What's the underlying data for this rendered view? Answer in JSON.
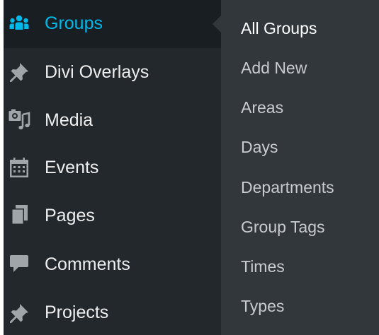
{
  "colors": {
    "menu_bg": "#23282d",
    "submenu_bg": "#32373c",
    "active_bg": "#191e23",
    "active_text": "#00b9eb",
    "menu_text": "#eeeeee",
    "icon_color": "#a0a5aa"
  },
  "menu": {
    "items": [
      {
        "label": "Groups",
        "icon": "groups-icon",
        "active": true
      },
      {
        "label": "Divi Overlays",
        "icon": "pushpin-icon"
      },
      {
        "label": "Media",
        "icon": "media-icon"
      },
      {
        "label": "Events",
        "icon": "calendar-icon"
      },
      {
        "label": "Pages",
        "icon": "pages-icon"
      },
      {
        "label": "Comments",
        "icon": "comment-icon"
      },
      {
        "label": "Projects",
        "icon": "pushpin-icon"
      }
    ]
  },
  "submenu": {
    "items": [
      {
        "label": "All Groups",
        "current": true
      },
      {
        "label": "Add New"
      },
      {
        "label": "Areas"
      },
      {
        "label": "Days"
      },
      {
        "label": "Departments"
      },
      {
        "label": "Group Tags"
      },
      {
        "label": "Times"
      },
      {
        "label": "Types"
      }
    ]
  }
}
